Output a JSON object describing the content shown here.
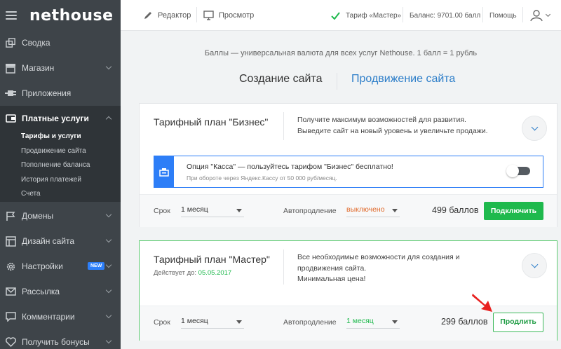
{
  "sidebar": {
    "logo": "nethouse",
    "items": [
      {
        "label": "Сводка"
      },
      {
        "label": "Магазин"
      },
      {
        "label": "Приложения"
      },
      {
        "label": "Платные услуги"
      },
      {
        "label": "Домены"
      },
      {
        "label": "Дизайн сайта"
      },
      {
        "label": "Настройки",
        "badge": "NEW"
      },
      {
        "label": "Рассылка"
      },
      {
        "label": "Комментарии"
      },
      {
        "label": "Получить бонусы"
      }
    ],
    "subitems": [
      "Тарифы и услуги",
      "Продвижение сайта",
      "Пополнение баланса",
      "История платежей",
      "Счета"
    ]
  },
  "topbar": {
    "editor": "Редактор",
    "preview": "Просмотр",
    "tariff": "Тариф «Мастер»",
    "balance": "Баланс: 9701.00 балл",
    "help": "Помощь"
  },
  "intro": "Баллы — универсальная валюта для всех услуг Nethouse. 1 балл = 1 рубль",
  "tabs": [
    "Создание сайта",
    "Продвижение сайта"
  ],
  "plans": [
    {
      "title": "Тарифный план \"Бизнес\"",
      "desc1": "Получите максимум возможностей для развития.",
      "desc2": "Выведите сайт на новый уровень и увеличьте продажи.",
      "kassa_title": "Опция \"Касса\" — пользуйтесь тарифом \"Бизнес\" бесплатно!",
      "kassa_sub": "При обороте через Яндекс.Кассу от 50 000 руб/месяц.",
      "term_label": "Срок",
      "term_value": "1 месяц",
      "auto_label": "Автопродление",
      "auto_value": "выключено",
      "price": "499 баллов",
      "button": "Подключить"
    },
    {
      "title": "Тарифный план \"Мастер\"",
      "valid_label": "Действует до:",
      "valid_date": "05.05.2017",
      "desc1": "Все необходимые возможности для создания и",
      "desc2": "продвижения сайта.",
      "desc3": "Минимальная цена!",
      "term_label": "Срок",
      "term_value": "1 месяц",
      "auto_label": "Автопродление",
      "auto_value": "1 месяц",
      "price": "299 баллов",
      "button": "Продлить"
    }
  ],
  "colors": {
    "accent_blue": "#2d7ec9",
    "green": "#1fb94d",
    "orange": "#e0692a",
    "sidebar": "#3e4449"
  }
}
